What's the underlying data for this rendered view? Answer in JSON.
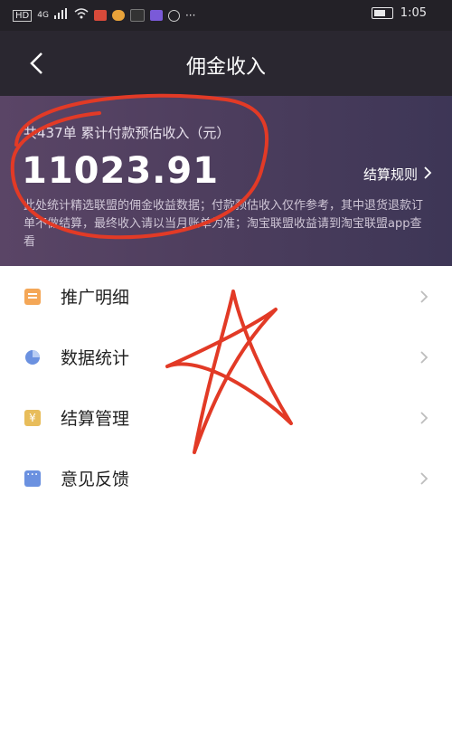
{
  "status": {
    "time": "1:05",
    "network": "4G"
  },
  "nav": {
    "title": "佣金收入"
  },
  "banner": {
    "subtitle": "共437单 累计付款预估收入（元）",
    "amount": "11023.91",
    "rule_link": "结算规则",
    "note": "此处统计精选联盟的佣金收益数据；付款预估收入仅作参考，其中退货退款订单不做结算，最终收入请以当月账单为准；淘宝联盟收益请到淘宝联盟app查看"
  },
  "menu": [
    {
      "label": "推广明细",
      "icon": "document-icon"
    },
    {
      "label": "数据统计",
      "icon": "pie-chart-icon"
    },
    {
      "label": "结算管理",
      "icon": "yen-icon"
    },
    {
      "label": "意见反馈",
      "icon": "chat-icon"
    }
  ],
  "colors": {
    "annotation": "#e23a26",
    "banner": "#4e3e5e",
    "nav": "#2a2730"
  }
}
